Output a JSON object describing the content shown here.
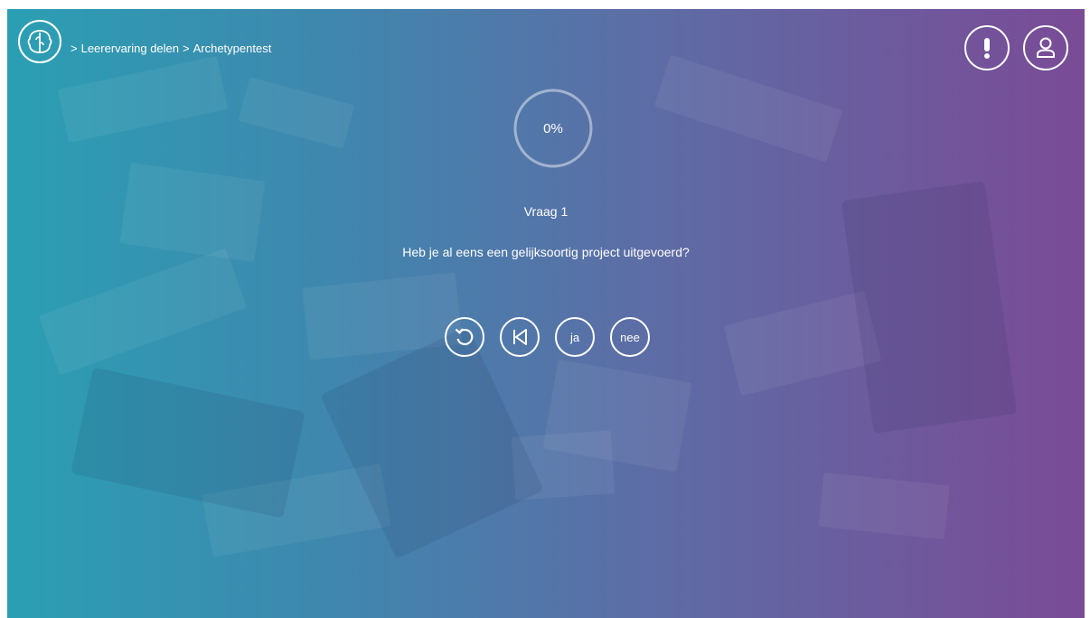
{
  "breadcrumb": {
    "sep1": ">",
    "item1": "Leerervaring delen",
    "sep2": ">",
    "item2": "Archetypentest"
  },
  "progress": {
    "label": "0%",
    "value": 0
  },
  "question": {
    "number": "Vraag 1",
    "text": "Heb je al eens een gelijksoortig project uitgevoerd?"
  },
  "controls": {
    "yes_label": "ja",
    "no_label": "nee"
  },
  "colors": {
    "gradient_start": "#2b9fb3",
    "gradient_end": "#7a4b96",
    "foreground": "#ffffff"
  }
}
